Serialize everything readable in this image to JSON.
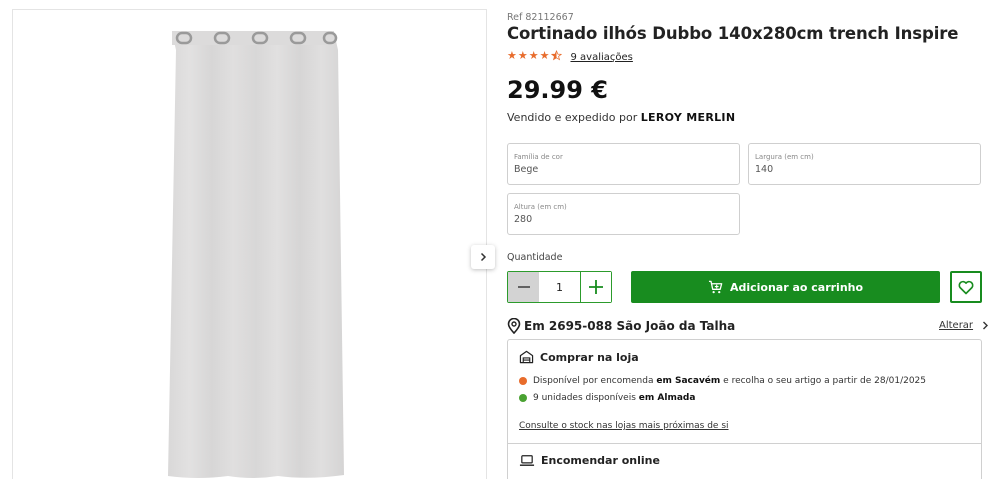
{
  "product": {
    "ref": "Ref 82112667",
    "title": "Cortinado ilhós Dubbo 140x280cm trench Inspire",
    "rating": 4.5,
    "reviews": "9 avaliações",
    "price": "29.99 €",
    "seller_prefix": "Vendido e expedido por",
    "seller_name": "LEROY MERLIN"
  },
  "options": {
    "color": {
      "label": "Família de cor",
      "value": "Bege"
    },
    "width": {
      "label": "Largura (em cm)",
      "value": "140"
    },
    "height": {
      "label": "Altura (em cm)",
      "value": "280"
    }
  },
  "quantity": {
    "label": "Quantidade",
    "value": "1"
  },
  "actions": {
    "add_to_cart": "Adicionar ao carrinho"
  },
  "location": {
    "text": "Em 2695-088 São João da Talha",
    "change": "Alterar"
  },
  "store": {
    "heading": "Comprar na loja",
    "availability": [
      {
        "color": "#e86c2c",
        "prefix": "Disponível por encomenda",
        "store": "em Sacavém",
        "suffix": "e recolha o seu artigo a partir de 28/01/2025"
      },
      {
        "color": "#4aa232",
        "prefix": "9 unidades disponíveis",
        "store": "em Almada",
        "suffix": ""
      }
    ],
    "consult": "Consulte o stock nas lojas mais próximas de si"
  },
  "online": {
    "heading": "Encomendar online"
  },
  "colors": {
    "brand_green": "#188c1f",
    "star_orange": "#e86c2c"
  }
}
